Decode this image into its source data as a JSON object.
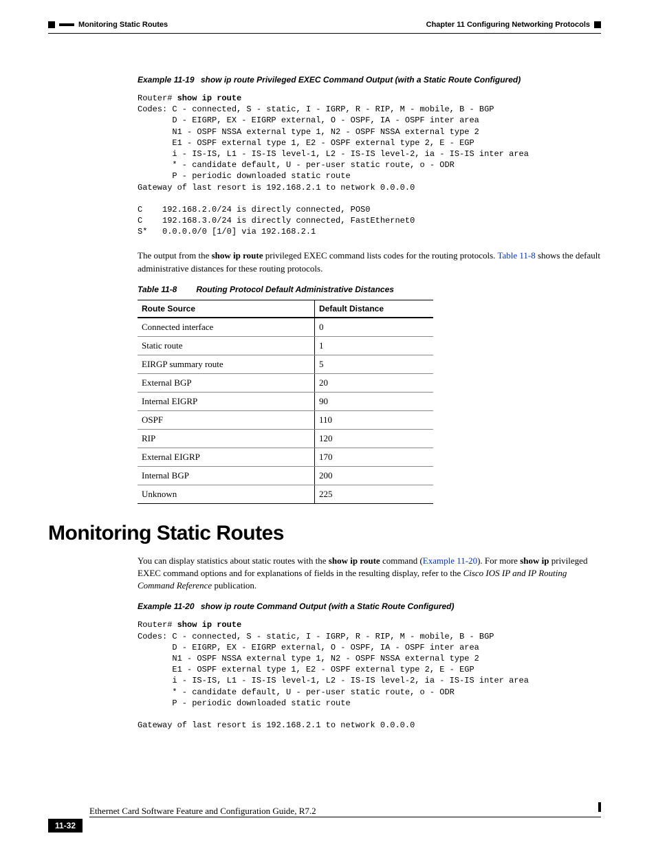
{
  "header": {
    "left_text": "Monitoring Static Routes",
    "right_text": "Chapter 11 Configuring Networking Protocols"
  },
  "example19": {
    "num": "Example 11-19",
    "title": "show ip route Privileged EXEC Command Output (with a Static Route Configured)",
    "prompt": "Router# ",
    "cmd": "show ip route",
    "body": "Codes: C - connected, S - static, I - IGRP, R - RIP, M - mobile, B - BGP\n       D - EIGRP, EX - EIGRP external, O - OSPF, IA - OSPF inter area\n       N1 - OSPF NSSA external type 1, N2 - OSPF NSSA external type 2\n       E1 - OSPF external type 1, E2 - OSPF external type 2, E - EGP\n       i - IS-IS, L1 - IS-IS level-1, L2 - IS-IS level-2, ia - IS-IS inter area\n       * - candidate default, U - per-user static route, o - ODR\n       P - periodic downloaded static route\nGateway of last resort is 192.168.2.1 to network 0.0.0.0\n\nC    192.168.2.0/24 is directly connected, POS0\nC    192.168.3.0/24 is directly connected, FastEthernet0\nS*   0.0.0.0/0 [1/0] via 192.168.2.1"
  },
  "para1": {
    "t1": "The output from the ",
    "b1": "show ip route",
    "t2": " privileged EXEC command lists codes for the routing protocols. ",
    "link": "Table 11-8",
    "t3": " shows the default administrative distances for these routing protocols."
  },
  "table": {
    "num": "Table 11-8",
    "title": "Routing Protocol Default Administrative Distances",
    "h1": "Route Source",
    "h2": "Default Distance",
    "rows": [
      {
        "src": "Connected interface",
        "dist": "0"
      },
      {
        "src": "Static route",
        "dist": "1"
      },
      {
        "src": "EIRGP summary route",
        "dist": "5"
      },
      {
        "src": "External BGP",
        "dist": "20"
      },
      {
        "src": "Internal EIGRP",
        "dist": "90"
      },
      {
        "src": "OSPF",
        "dist": "110"
      },
      {
        "src": "RIP",
        "dist": "120"
      },
      {
        "src": "External EIGRP",
        "dist": "170"
      },
      {
        "src": "Internal BGP",
        "dist": "200"
      },
      {
        "src": "Unknown",
        "dist": "225"
      }
    ]
  },
  "section_heading": "Monitoring Static Routes",
  "para2": {
    "t1": "You can display statistics about static routes with the ",
    "b1": "show ip route",
    "t2": " command (",
    "link": "Example 11-20",
    "t3": "). For more ",
    "b2": "show ip",
    "t4": " privileged EXEC command options and for explanations of fields in the resulting display, refer to the ",
    "i1": "Cisco IOS IP and IP Routing Command Reference",
    "t5": " publication."
  },
  "example20": {
    "num": "Example 11-20",
    "title": "show ip route Command Output (with a Static Route Configured)",
    "prompt": "Router# ",
    "cmd": "show ip route",
    "body": "Codes: C - connected, S - static, I - IGRP, R - RIP, M - mobile, B - BGP\n       D - EIGRP, EX - EIGRP external, O - OSPF, IA - OSPF inter area\n       N1 - OSPF NSSA external type 1, N2 - OSPF NSSA external type 2\n       E1 - OSPF external type 1, E2 - OSPF external type 2, E - EGP\n       i - IS-IS, L1 - IS-IS level-1, L2 - IS-IS level-2, ia - IS-IS inter area\n       * - candidate default, U - per-user static route, o - ODR\n       P - periodic downloaded static route\n\nGateway of last resort is 192.168.2.1 to network 0.0.0.0"
  },
  "footer": {
    "title": "Ethernet Card Software Feature and Configuration Guide, R7.2",
    "page": "11-32"
  }
}
